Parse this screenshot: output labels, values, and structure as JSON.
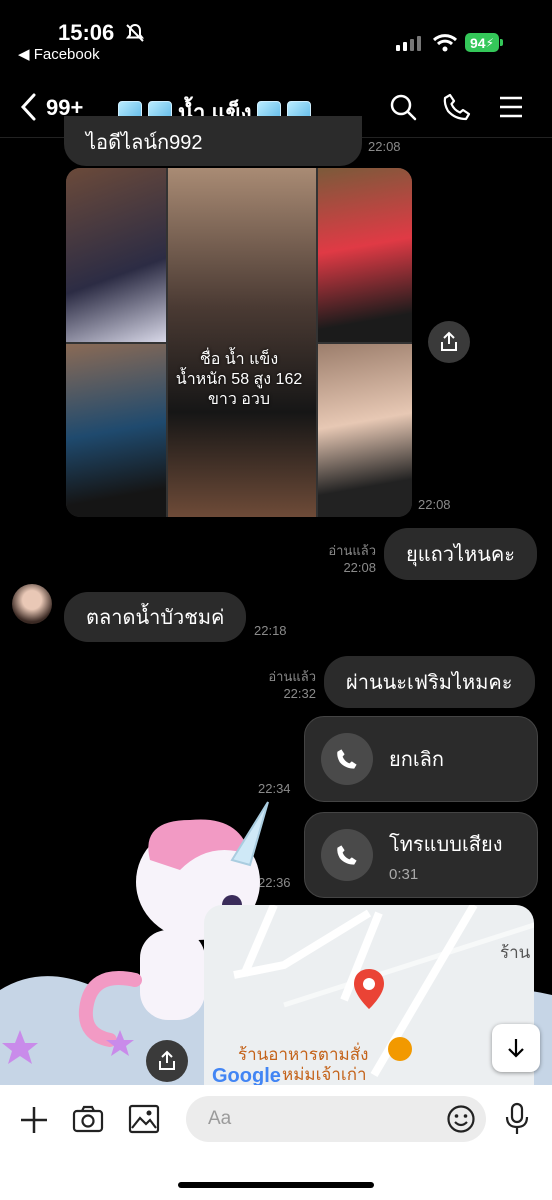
{
  "status_bar": {
    "time": "15:06",
    "back_app": "◀ Facebook",
    "battery": "94"
  },
  "header": {
    "unread_count": "99+",
    "title": "น้ำ แข็ง"
  },
  "messages": {
    "top_partial_text": "ไอดีไลน์ก992",
    "top_partial_time": "22:08",
    "photo_caption_line1": "ชื่อ น้ำ แข็ง",
    "photo_caption_line2": "น้ำหนัก 58 สูง 162",
    "photo_caption_line3": "ขาว อวบ",
    "photo_time": "22:08",
    "out1_read": "อ่านแล้ว",
    "out1_time": "22:08",
    "out1_text": "ยุแถวไหนคะ",
    "in1_text": "ตลาดน้ำบัวชมค่",
    "in1_time": "22:18",
    "out2_read": "อ่านแล้ว",
    "out2_time": "22:32",
    "out2_text": "ผ่านนะเฟริมไหมคะ",
    "call1_label": "ยกเลิก",
    "call1_time": "22:34",
    "call2_label": "โทรแบบเสียง",
    "call2_duration": "0:31",
    "call2_time": "22:36"
  },
  "map": {
    "place_name": "ร้านอาหารตามสั่ง",
    "place_name2": "หม่มเจ้าเก่า",
    "edge_label": "ร้าน",
    "google_logo": "Google"
  },
  "composer": {
    "placeholder": "Aa"
  },
  "colors": {
    "battery": "#34c759",
    "bubble": "#2b2b2b",
    "map_pin": "#ea4335",
    "map_label": "#c4631a"
  }
}
